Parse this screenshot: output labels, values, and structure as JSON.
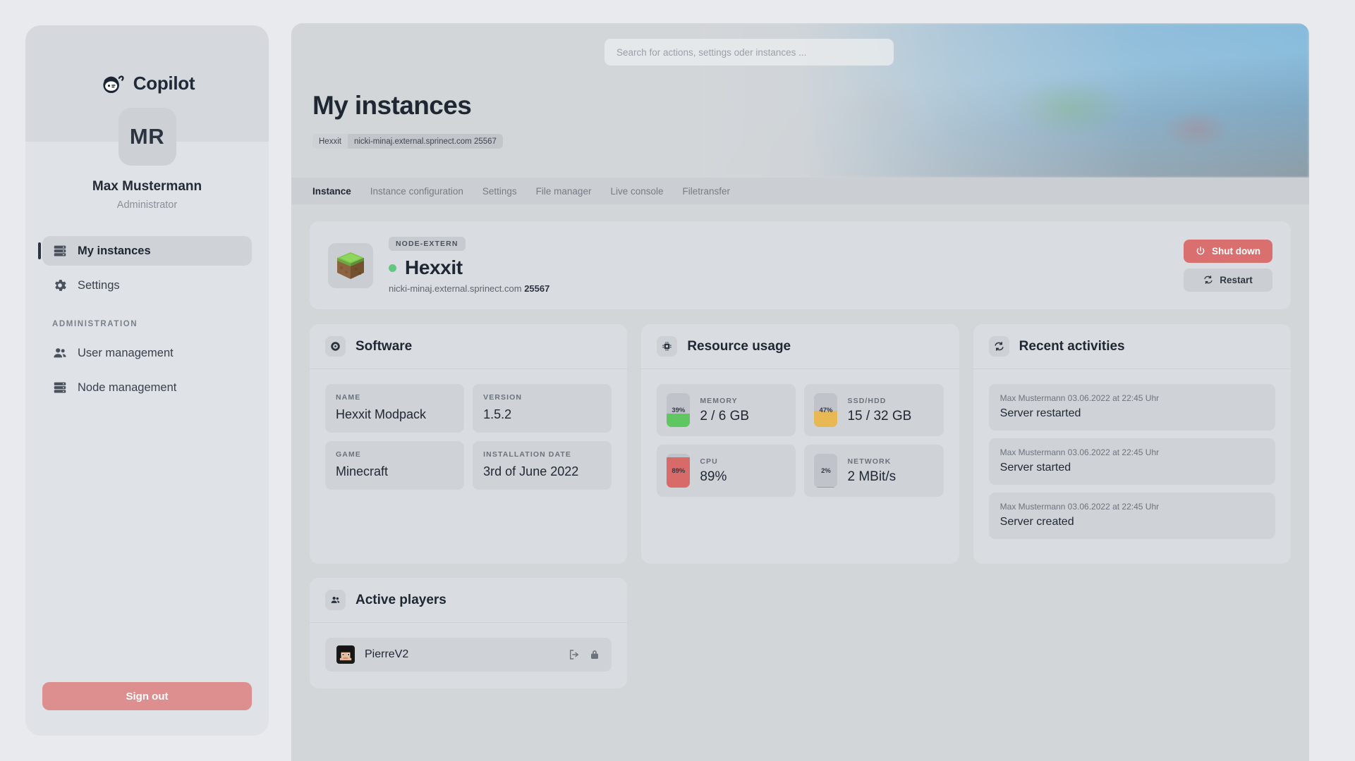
{
  "brand": {
    "name": "Copilot",
    "logo_icon": "copilot-robot-logo"
  },
  "sidebar": {
    "avatar_initials": "MR",
    "user_name": "Max Mustermann",
    "user_role": "Administrator",
    "items": [
      {
        "label": "My instances",
        "icon": "server-stack-icon",
        "active": true
      },
      {
        "label": "Settings",
        "icon": "gear-icon",
        "active": false
      }
    ],
    "section_label": "ADMINISTRATION",
    "admin_items": [
      {
        "label": "User management",
        "icon": "users-icon"
      },
      {
        "label": "Node management",
        "icon": "server-stack-icon"
      }
    ],
    "signout_label": "Sign out"
  },
  "header": {
    "search_placeholder": "Search for actions, settings oder instances ...",
    "page_title": "My instances",
    "breadcrumb": {
      "instance": "Hexxit",
      "host": "nicki-minaj.external.sprinect.com 25567"
    }
  },
  "tabs": [
    {
      "label": "Instance",
      "active": true
    },
    {
      "label": "Instance configuration",
      "active": false
    },
    {
      "label": "Settings",
      "active": false
    },
    {
      "label": "File manager",
      "active": false
    },
    {
      "label": "Live console",
      "active": false
    },
    {
      "label": "Filetransfer",
      "active": false
    }
  ],
  "instance": {
    "thumb_icon": "minecraft-grass-block-icon",
    "badge": "NODE-EXTERN",
    "status": "online",
    "name": "Hexxit",
    "host": "nicki-minaj.external.sprinect.com",
    "port": "25567",
    "shutdown_label": "Shut down",
    "restart_label": "Restart"
  },
  "software": {
    "title": "Software",
    "icon": "disc-icon",
    "fields": [
      {
        "label": "NAME",
        "value": "Hexxit Modpack"
      },
      {
        "label": "VERSION",
        "value": "1.5.2"
      },
      {
        "label": "GAME",
        "value": "Minecraft"
      },
      {
        "label": "INSTALLATION DATE",
        "value": "3rd of June 2022"
      }
    ]
  },
  "resources": {
    "title": "Resource usage",
    "icon": "cpu-chip-icon",
    "metrics": [
      {
        "label": "MEMORY",
        "value": "2 / 6 GB",
        "percent": 39,
        "percent_text": "39%",
        "color": "#5fc662"
      },
      {
        "label": "SSD/HDD",
        "value": "15 / 32 GB",
        "percent": 47,
        "percent_text": "47%",
        "color": "#e8b855"
      },
      {
        "label": "CPU",
        "value": "89%",
        "percent": 89,
        "percent_text": "89%",
        "color": "#d96a6a"
      },
      {
        "label": "NETWORK",
        "value": "2 MBit/s",
        "percent": 2,
        "percent_text": "2%",
        "color": "#5fc662"
      }
    ]
  },
  "activities": {
    "title": "Recent activities",
    "icon": "refresh-icon",
    "items": [
      {
        "meta": "Max Mustermann 03.06.2022 at 22:45 Uhr",
        "text": "Server restarted"
      },
      {
        "meta": "Max Mustermann 03.06.2022 at 22:45 Uhr",
        "text": "Server started"
      },
      {
        "meta": "Max Mustermann 03.06.2022 at 22:45 Uhr",
        "text": "Server created"
      }
    ]
  },
  "players": {
    "title": "Active players",
    "icon": "users-icon",
    "items": [
      {
        "name": "PierreV2",
        "kick_icon": "kick-arrow-icon",
        "ban_icon": "lock-icon"
      }
    ]
  },
  "colors": {
    "page_bg": "#e8eaed",
    "sidebar_bg": "#dfe2e6",
    "panel_bg": "#d3d6d9",
    "card_bg": "#d9dce0",
    "field_bg": "#cfd2d7",
    "danger": "#d96f6f",
    "signout": "#dd8f8f",
    "status_online": "#5fc97f",
    "text_primary": "#1f2733",
    "text_muted": "#6a727c"
  }
}
